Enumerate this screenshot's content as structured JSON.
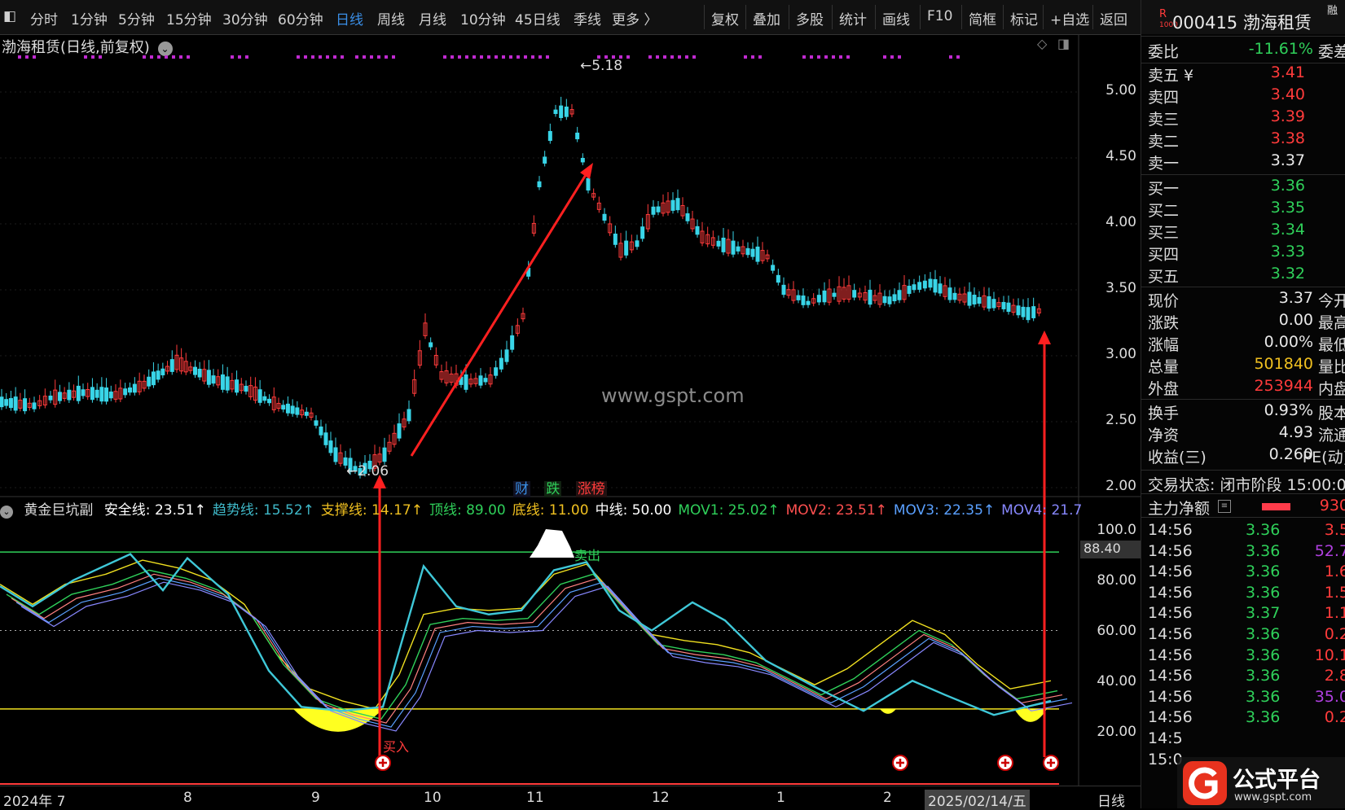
{
  "toolbar": {
    "left_items": [
      "分时",
      "1分钟",
      "5分钟",
      "15分钟",
      "30分钟",
      "60分钟",
      "日线",
      "周线",
      "月线",
      "10分钟",
      "45日线",
      "季线",
      "更多 〉"
    ],
    "active": "日线",
    "right_items": [
      "复权",
      "叠加",
      "多股",
      "统计",
      "画线",
      "F10",
      "简框",
      "标记",
      "+自选",
      "返回"
    ]
  },
  "stock": {
    "code_name": "000415 渤海租赁",
    "badge": "R",
    "badge_sub": "1000",
    "corner": "融"
  },
  "chart_title": "渤海租赁(日线,前复权)",
  "price_axis": [
    "5.00",
    "4.50",
    "4.00",
    "3.50",
    "3.00",
    "2.50",
    "2.00"
  ],
  "annotations": {
    "high": "5.18",
    "low": "2.06",
    "watermark": "www.gspt.com",
    "sell": "卖出",
    "buy": "买入"
  },
  "event_tags": [
    {
      "text": "财",
      "color": "#3a8ee6"
    },
    {
      "text": "跌",
      "color": "#2fd05a"
    },
    {
      "text": "涨榜",
      "color": "#ff3b3b"
    }
  ],
  "indicator": {
    "name": "黄金巨坑副",
    "items": [
      {
        "label": "安全线: 23.51↑",
        "color": "#ffffff"
      },
      {
        "label": "趋势线: 15.52↑",
        "color": "#3fb8c8"
      },
      {
        "label": "支撑线: 14.17↑",
        "color": "#f0c020"
      },
      {
        "label": "顶线: 89.00",
        "color": "#2fd05a"
      },
      {
        "label": "底线: 11.00",
        "color": "#f0c020"
      },
      {
        "label": "中线: 50.00",
        "color": "#ffffff"
      },
      {
        "label": "MOV1: 25.02↑",
        "color": "#2fd05a"
      },
      {
        "label": "MOV2: 23.51↑",
        "color": "#ff5050"
      },
      {
        "label": "MOV3: 22.35↑",
        "color": "#5aa0ff"
      },
      {
        "label": "MOV4: 21.7",
        "color": "#8888ff"
      }
    ],
    "axis": [
      "100.0",
      "80.00",
      "60.00",
      "40.00",
      "20.00"
    ],
    "cursor_value": "88.40"
  },
  "date_axis": [
    "2024年 7",
    "8",
    "9",
    "10",
    "11",
    "12",
    "1",
    "2",
    "2025/02/14/五"
  ],
  "date_mode": "日线",
  "quote": {
    "weibi": {
      "label": "委比",
      "value": "-11.61%",
      "ext": "委差"
    },
    "sells": [
      {
        "label": "卖五 ¥",
        "price": "3.41"
      },
      {
        "label": "卖四",
        "price": "3.40"
      },
      {
        "label": "卖三",
        "price": "3.39"
      },
      {
        "label": "卖二",
        "price": "3.38"
      },
      {
        "label": "卖一",
        "price": "3.37"
      }
    ],
    "buys": [
      {
        "label": "买一",
        "price": "3.36"
      },
      {
        "label": "买二",
        "price": "3.35"
      },
      {
        "label": "买三",
        "price": "3.34"
      },
      {
        "label": "买四",
        "price": "3.33"
      },
      {
        "label": "买五",
        "price": "3.32"
      }
    ],
    "stats": [
      {
        "label": "现价",
        "value": "3.37",
        "ext": "今开",
        "cls": "wht"
      },
      {
        "label": "涨跌",
        "value": "0.00",
        "ext": "最高",
        "cls": "wht"
      },
      {
        "label": "涨幅",
        "value": "0.00%",
        "ext": "最低",
        "cls": "wht"
      },
      {
        "label": "总量",
        "value": "501840",
        "ext": "量比",
        "cls": "yel"
      },
      {
        "label": "外盘",
        "value": "253944",
        "ext": "内盘",
        "cls": "red"
      }
    ],
    "stats2": [
      {
        "label": "换手",
        "value": "0.93%",
        "ext": "股本"
      },
      {
        "label": "净资",
        "value": "4.93",
        "ext": "流通"
      },
      {
        "label": "收益(三)",
        "value": "0.260",
        "ext": "PE(动)"
      }
    ],
    "trade_status": "交易状态: 闭市阶段 15:00:0",
    "main_net": {
      "label": "主力净额",
      "value": "930"
    },
    "ticks": [
      {
        "time": "14:56",
        "price": "3.36",
        "vol": "3.5"
      },
      {
        "time": "14:56",
        "price": "3.36",
        "vol": "52.7"
      },
      {
        "time": "14:56",
        "price": "3.36",
        "vol": "1.6"
      },
      {
        "time": "14:56",
        "price": "3.36",
        "vol": "1.5"
      },
      {
        "time": "14:56",
        "price": "3.37",
        "vol": "1.1"
      },
      {
        "time": "14:56",
        "price": "3.36",
        "vol": "0.2"
      },
      {
        "time": "14:56",
        "price": "3.36",
        "vol": "10.1"
      },
      {
        "time": "14:56",
        "price": "3.36",
        "vol": "2.8"
      },
      {
        "time": "14:56",
        "price": "3.36",
        "vol": "35.0"
      },
      {
        "time": "14:56",
        "price": "3.36",
        "vol": "0.2"
      },
      {
        "time": "14:5",
        "price": "",
        "vol": ""
      },
      {
        "time": "15:0",
        "price": "",
        "vol": ""
      }
    ]
  },
  "brand": {
    "name": "公式平台",
    "url": "www.gspt.com"
  }
}
